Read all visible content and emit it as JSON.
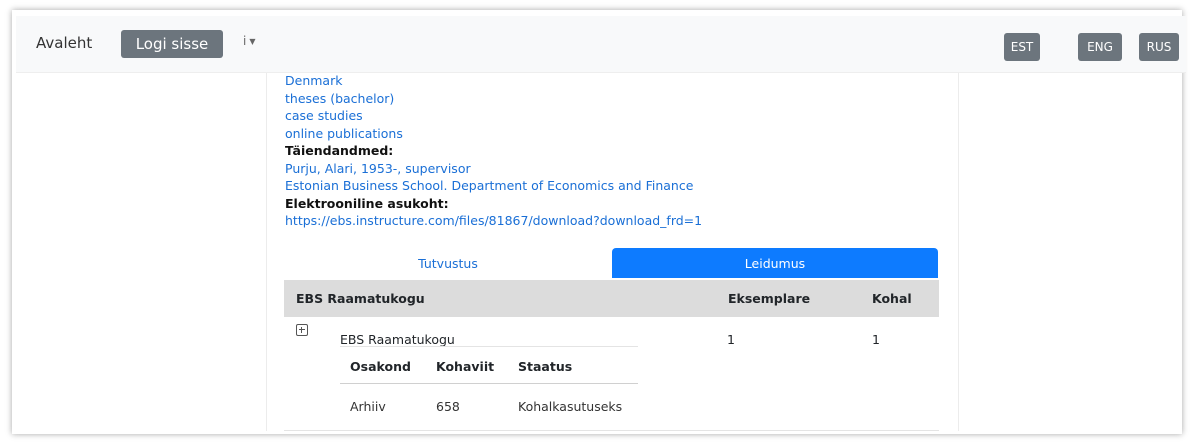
{
  "nav": {
    "home": "Avaleht",
    "login": "Logi sisse",
    "info_icon": "i"
  },
  "languages": [
    "EST",
    "ENG",
    "RUS"
  ],
  "record": {
    "subjects": [
      "Denmark",
      "theses (bachelor)",
      "case studies",
      "online publications"
    ],
    "additional_label": "Täiendandmed:",
    "additional": [
      "Purju, Alari, 1953-, supervisor",
      "Estonian Business School. Department of Economics and Finance"
    ],
    "location_label": "Elektrooniline asukoht:",
    "location_url": "https://ebs.instructure.com/files/81867/download?download_frd=1"
  },
  "tabs": {
    "tutvustus": "Tutvustus",
    "leidumus": "Leidumus"
  },
  "holdings": {
    "headers": [
      "EBS Raamatukogu",
      "Eksemplare",
      "Kohal"
    ],
    "row": [
      "EBS Raamatukogu",
      "1",
      "1"
    ],
    "sub_headers": [
      "Osakond",
      "Kohaviit",
      "Staatus"
    ],
    "sub_row": [
      "Arhiiv",
      "658",
      "Kohalkasutuseks"
    ]
  },
  "colors": {
    "accent": "#0d7bff",
    "link": "#1a6fd6",
    "button": "#6c757d"
  }
}
